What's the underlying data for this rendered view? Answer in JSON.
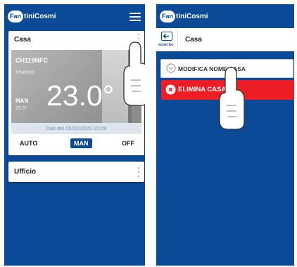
{
  "left_screen": {
    "app_logo": {
      "badge": "Fan",
      "text": "tiniCosmi"
    },
    "card_casa": {
      "title": "Casa",
      "device_name": "CH119NFC",
      "season": "Inverno",
      "mode": "MAN",
      "setpoint": "20.5°",
      "temperature": "23.0°",
      "updated": "Dati del 05/02/2020 10:09",
      "mode_buttons": [
        "AUTO",
        "MAN",
        "OFF"
      ],
      "active_mode": "MAN"
    },
    "card_ufficio": {
      "title": "Ufficio"
    }
  },
  "right_screen": {
    "app_logo": {
      "badge": "Fan",
      "text": "tiniCosmi"
    },
    "header": {
      "back_label": "INDIETRO",
      "title": "Casa"
    },
    "menu": {
      "rename_label": "MODIFICA NOME CASA",
      "delete_label": "ELIMINA CASA"
    }
  },
  "colors": {
    "brand_blue": "#0b4a96",
    "danger_red": "#ef1d26",
    "white": "#ffffff"
  },
  "icons": [
    "menu-icon",
    "more-vertical-icon",
    "back-icon",
    "chevron-down-circle-icon",
    "close-circle-icon",
    "pointing-hand-icon"
  ]
}
